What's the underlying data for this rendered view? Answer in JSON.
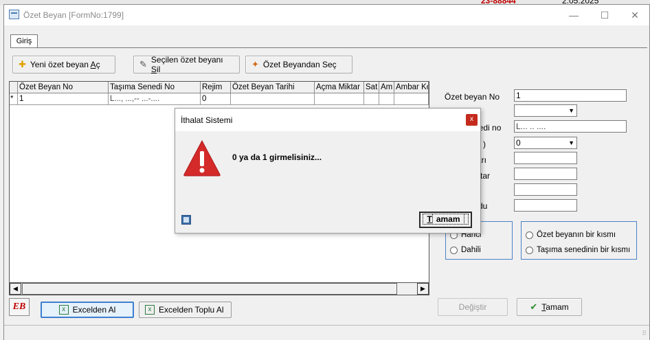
{
  "background_app": {
    "code_fragment": "23-88844",
    "date_fragment": "2.05.2025"
  },
  "window": {
    "title": "Özet Beyan [FormNo:1799]",
    "minimize": "—",
    "maximize": "☐",
    "close": "✕"
  },
  "tabs": [
    {
      "label": "Giriş"
    }
  ],
  "toolbar": {
    "new_pre": "Yeni özet beyan ",
    "new_key": "A",
    "new_post": "ç",
    "delete_pre": "Seçilen özet beyanı ",
    "delete_key": "S",
    "delete_post": "il",
    "select_label": "Özet Beyandan Seç"
  },
  "grid": {
    "columns": [
      "Özet Beyan No",
      "Taşıma Senedi No",
      "Rejim",
      "Özet Beyan Tarihi",
      "Açma Miktar",
      "Sat",
      "Am",
      "Ambar Ko"
    ],
    "row": {
      "marker": "*",
      "values": [
        "1",
        "L..., ...,-- ...-....",
        "0",
        "",
        "",
        "",
        "",
        ""
      ]
    }
  },
  "form": {
    "ozet_beyan_no_label": "Özet beyan No",
    "ozet_beyan_no_value": "1",
    "row2_label": "",
    "senedi_no_label": "nedi no",
    "senedi_no_value": "L... .. ....",
    "row4_label": ")",
    "row4_value": "0",
    "row5_label": "arı",
    "row6_label": "ktar",
    "row8_label": "du"
  },
  "radios": {
    "left": [
      "Harici",
      "Dahili"
    ],
    "right": [
      "Özet beyanın bir kısmı",
      "Taşıma senedinin bir kısmı"
    ]
  },
  "bottom": {
    "excel_label": "Excelden Al",
    "excel_bulk_label": "Excelden Toplu Al",
    "change_label": "Değiştir",
    "ok_key": "T",
    "ok_rest": "amam",
    "logo_text": "EB"
  },
  "dialog": {
    "title": "İthalat Sistemi",
    "message": "0 ya da 1 girmelisiniz...",
    "ok_key": "T",
    "ok_rest": "amam",
    "close": "x"
  },
  "colors": {
    "accent": "#4a80c8",
    "error_red": "#d42a2a",
    "close_red": "#c42b1c"
  }
}
